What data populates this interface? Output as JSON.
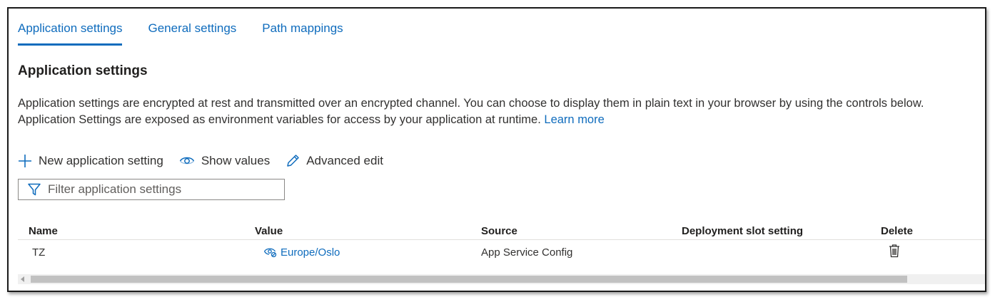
{
  "tabs": [
    {
      "label": "Application settings",
      "active": true
    },
    {
      "label": "General settings",
      "active": false
    },
    {
      "label": "Path mappings",
      "active": false
    }
  ],
  "section": {
    "title": "Application settings",
    "desc_line1": "Application settings are encrypted at rest and transmitted over an encrypted channel. You can choose to display them in plain text in your browser by using the controls below.",
    "desc_line2": "Application Settings are exposed as environment variables for access by your application at runtime.",
    "learn_more": "Learn more"
  },
  "toolbar": {
    "new_label": "New application setting",
    "show_label": "Show values",
    "advanced_label": "Advanced edit"
  },
  "filter": {
    "placeholder": "Filter application settings"
  },
  "table": {
    "headers": {
      "name": "Name",
      "value": "Value",
      "source": "Source",
      "slot": "Deployment slot setting",
      "delete": "Delete"
    },
    "rows": [
      {
        "name": "TZ",
        "value": "Europe/Oslo",
        "source": "App Service Config",
        "slot": ""
      }
    ]
  },
  "icons": {
    "add": "plus-icon",
    "show": "eye-icon",
    "edit": "pencil-icon",
    "filter": "funnel-icon",
    "hidden": "eye-hidden-icon",
    "delete": "trash-icon"
  },
  "colors": {
    "accent": "#0f6cbd",
    "text": "#323130"
  }
}
